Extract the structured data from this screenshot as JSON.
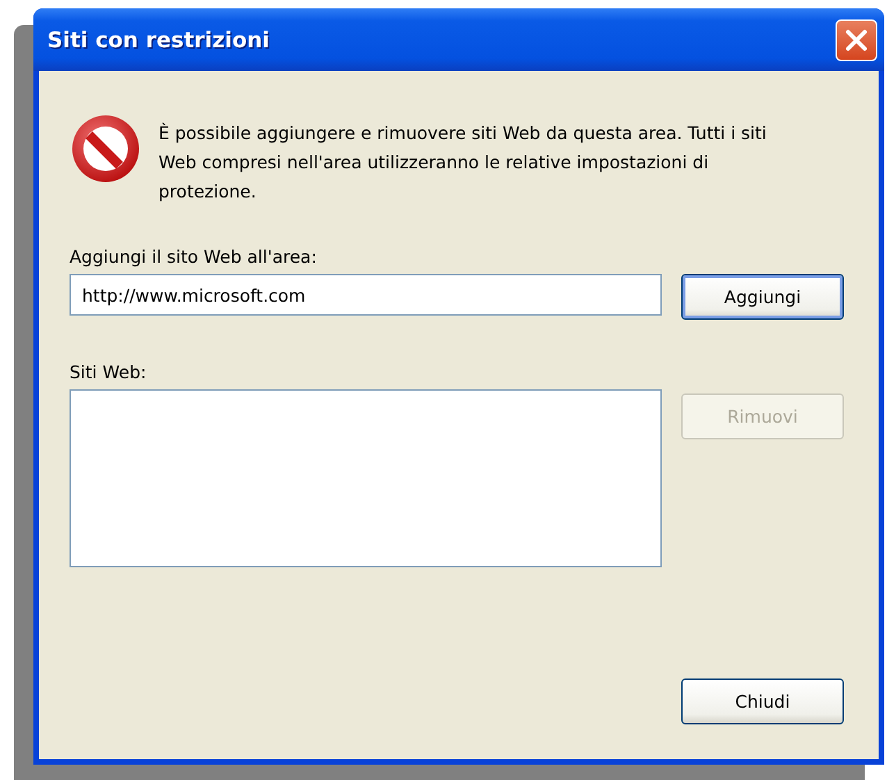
{
  "window": {
    "title": "Siti con restrizioni"
  },
  "message": "È possibile aggiungere e rimuovere siti Web da questa area. Tutti i siti Web compresi nell'area utilizzeranno le relative impostazioni di protezione.",
  "add_label": "Aggiungi il sito Web all'area:",
  "site_field": {
    "value": "http://www.microsoft.com"
  },
  "add_button": {
    "label": "Aggiungi",
    "default": true,
    "disabled": false
  },
  "sites_label": "Siti Web:",
  "remove_button": {
    "label": "Rimuovi",
    "default": false,
    "disabled": true
  },
  "close_button": {
    "label": "Chiudi",
    "default": false,
    "disabled": false
  }
}
